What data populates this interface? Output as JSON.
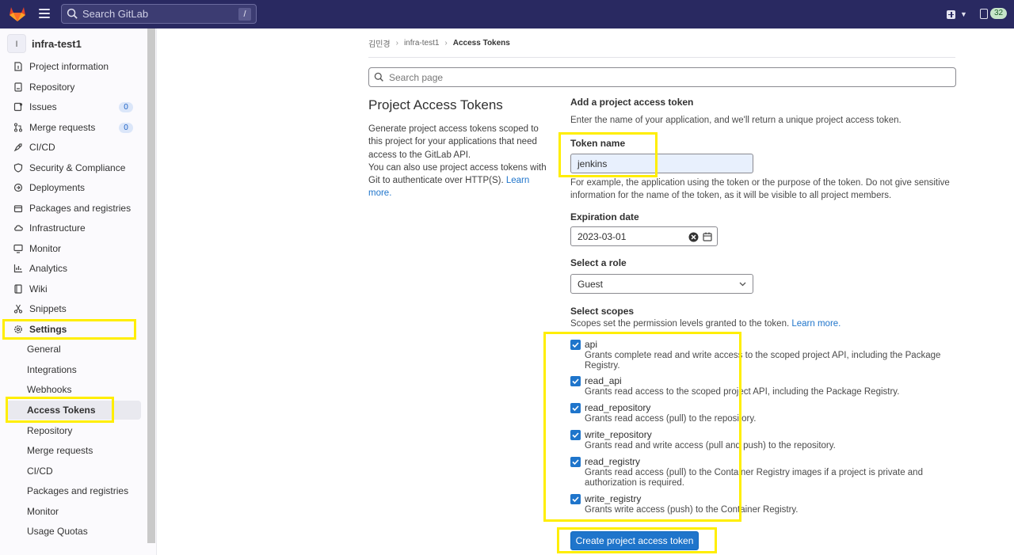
{
  "topbar": {
    "search_placeholder": "Search GitLab",
    "search_shortcut": "/",
    "mr_count": "32"
  },
  "sidebar": {
    "project_avatar": "I",
    "project_name": "infra-test1",
    "items": [
      {
        "label": "Project information",
        "icon": "info-icon"
      },
      {
        "label": "Repository",
        "icon": "doc-icon"
      },
      {
        "label": "Issues",
        "icon": "issues-icon",
        "badge": "0"
      },
      {
        "label": "Merge requests",
        "icon": "merge-icon",
        "badge": "0"
      },
      {
        "label": "CI/CD",
        "icon": "rocket-icon"
      },
      {
        "label": "Security & Compliance",
        "icon": "shield-icon"
      },
      {
        "label": "Deployments",
        "icon": "deploy-icon"
      },
      {
        "label": "Packages and registries",
        "icon": "package-icon"
      },
      {
        "label": "Infrastructure",
        "icon": "cloud-icon"
      },
      {
        "label": "Monitor",
        "icon": "monitor-icon"
      },
      {
        "label": "Analytics",
        "icon": "chart-icon"
      },
      {
        "label": "Wiki",
        "icon": "book-icon"
      },
      {
        "label": "Snippets",
        "icon": "scissors-icon"
      },
      {
        "label": "Settings",
        "icon": "gear-icon"
      }
    ],
    "settings_items": [
      "General",
      "Integrations",
      "Webhooks",
      "Access Tokens",
      "Repository",
      "Merge requests",
      "CI/CD",
      "Packages and registries",
      "Monitor",
      "Usage Quotas"
    ]
  },
  "breadcrumb": {
    "user": "김민경",
    "project": "infra-test1",
    "current": "Access Tokens"
  },
  "page_search_placeholder": "Search page",
  "left": {
    "title": "Project Access Tokens",
    "desc1": "Generate project access tokens scoped to this project for your applications that need access to the GitLab API.",
    "desc2": "You can also use project access tokens with Git to authenticate over HTTP(S).",
    "learn_more": "Learn more."
  },
  "form": {
    "heading": "Add a project access token",
    "intro": "Enter the name of your application, and we'll return a unique project access token.",
    "token_name_label": "Token name",
    "token_name_value": "jenkins",
    "token_name_help": "For example, the application using the token or the purpose of the token. Do not give sensitive information for the name of the token, as it will be visible to all project members.",
    "expiration_label": "Expiration date",
    "expiration_value": "2023-03-01",
    "role_label": "Select a role",
    "role_value": "Guest",
    "scopes_label": "Select scopes",
    "scopes_help": "Scopes set the permission levels granted to the token.",
    "scopes_learn_more": "Learn more.",
    "scopes": [
      {
        "name": "api",
        "checked": true,
        "desc": "Grants complete read and write access to the scoped project API, including the Package Registry."
      },
      {
        "name": "read_api",
        "checked": true,
        "desc": "Grants read access to the scoped project API, including the Package Registry."
      },
      {
        "name": "read_repository",
        "checked": true,
        "desc": "Grants read access (pull) to the repository."
      },
      {
        "name": "write_repository",
        "checked": true,
        "desc": "Grants read and write access (pull and push) to the repository."
      },
      {
        "name": "read_registry",
        "checked": true,
        "desc": "Grants read access (pull) to the Container Registry images if a project is private and authorization is required."
      },
      {
        "name": "write_registry",
        "checked": true,
        "desc": "Grants write access (push) to the Container Registry."
      }
    ],
    "submit_label": "Create project access token"
  },
  "colors": {
    "topbar": "#292961",
    "primary": "#1f75cb",
    "highlight": "#ffee00"
  }
}
